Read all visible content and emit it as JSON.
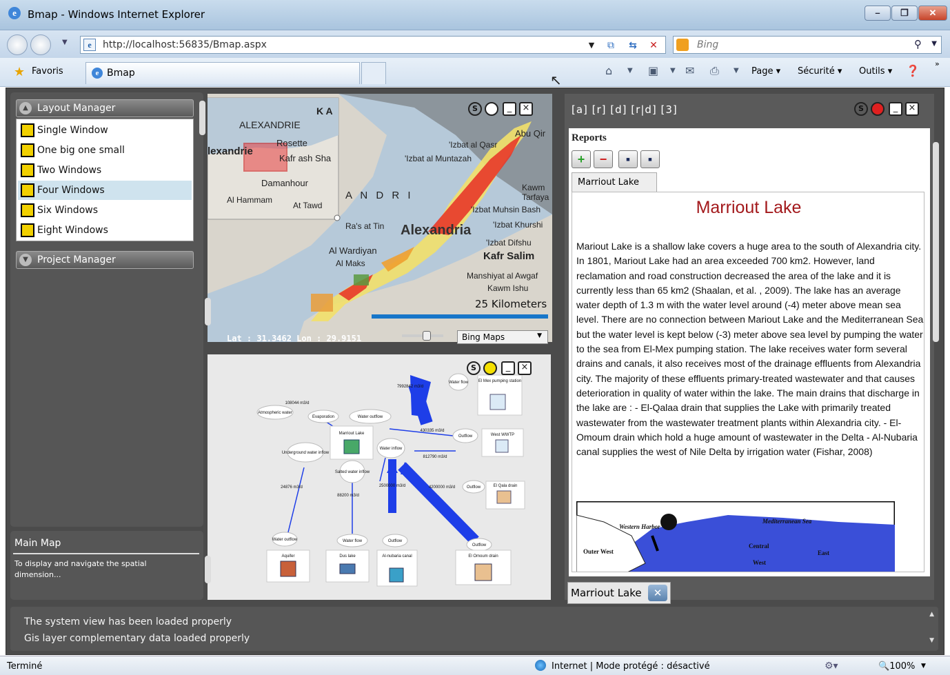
{
  "window": {
    "title": "Bmap - Windows Internet Explorer",
    "controls": {
      "minimize": "–",
      "maximize": "❐",
      "close": "✕"
    }
  },
  "address": {
    "url": "http://localhost:56835/Bmap.aspx",
    "search_placeholder": "Bing"
  },
  "favorites": {
    "label": "Favoris",
    "tab_label": "Bmap"
  },
  "command_bar": {
    "page": "Page ▾",
    "security": "Sécurité ▾",
    "tools": "Outils ▾",
    "more": "»"
  },
  "left_panel": {
    "layout_manager": "Layout Manager",
    "layouts": [
      {
        "label": "Single Window",
        "selected": false
      },
      {
        "label": "One big one small",
        "selected": false
      },
      {
        "label": "Two Windows",
        "selected": false
      },
      {
        "label": "Four Windows",
        "selected": true
      },
      {
        "label": "Six Windows",
        "selected": false
      },
      {
        "label": "Eight Windows",
        "selected": false
      }
    ],
    "project_manager": "Project Manager",
    "info_title": "Main Map",
    "info_text": "To display and navigate the spatial dimension..."
  },
  "map_window": {
    "controls": {
      "s": "S"
    },
    "labels": {
      "ka": "K A",
      "alexandrie": "ALEXANDRIE",
      "alexandrie_city": "lexandrie",
      "rosette": "Rosette",
      "kafr_ash_sh": "Kafr ash Sha",
      "damanhour": "Damanhour",
      "al_hammam": "Al Hammam",
      "at_tawd": "At Tawd",
      "abu_qir": "Abu Qir",
      "izbat_qasr": "'Izbat al Qasr",
      "izbat_muntazah": "'Izbat al Muntazah",
      "andria": "A N D R I",
      "kawm": "Kawm",
      "tarfaya": "Tarfaya",
      "izbat_muhsin": "'Izbat Muhsin Bash",
      "ras_at_tin": "Ra's at Tin",
      "alexandria": "Alexandria",
      "izbat_khurshid": "'Izbat Khurshi",
      "izbat_difshu": "'Izbat Difshu",
      "al_wardiyan": "Al Wardiyan",
      "al_maks": "Al Maks",
      "kafr_salim": "Kafr Salim",
      "manshiyat": "Manshiyat al Awgaf",
      "kawm_ishu": "Kawm Ishu",
      "scale": "25 Kilometers"
    },
    "lat_lon": "Lat : 31.3462   Lon : 29.9151",
    "map_type": "Bing Maps"
  },
  "diagram_window": {
    "controls": {
      "s": "S"
    },
    "labels": {
      "flow_7992": "7992842 m3/d",
      "water_flow_1": "Water flow",
      "el_mex_station": "El Mex pumping station",
      "flow_108044": "108044 m3/d",
      "atmospheric_water": "Atmospheric water",
      "evaporation": "Evaporation",
      "water_outflow": "Water outflow",
      "marriout_lake": "Marriout Lake",
      "flow_430335": "430335 m3/d",
      "outflow_1": "Outflow",
      "west_wwtp": "West WWTP",
      "underground_inflow": "Underground water inflow",
      "water_inflow": "Water inflow",
      "flow_812790": "812790 m3/d",
      "salted_inflow": "Salted water inflow",
      "flow_24876": "24876 m3/d",
      "flow_88200": "88200 m3/d",
      "flow_2500000": "2500000 m3/d",
      "flow_4200000": "4200000 m3/d",
      "outflow_2": "Outflow",
      "el_qala_drain": "El Qala drain",
      "water_outflow_2": "Water outflow",
      "water_flow_2": "Water flow",
      "outflow_3": "Outflow",
      "outflow_4": "Outflow",
      "aquifer": "Aquifer",
      "dus_lake": "Dus lake",
      "al_nubaria": "Al-nubaria canal",
      "el_omoum_drain": "El Omoum drain"
    }
  },
  "report_window": {
    "toolbar_label": "[a] [r] [d] [r|d] [3]",
    "controls": {
      "s": "S"
    },
    "reports_title": "Reports",
    "buttons": {
      "add": "+",
      "remove": "−",
      "save": "▪",
      "save_all": "▪"
    },
    "tab": "Marriout Lake",
    "content_title": "Marriout Lake",
    "content_body": "Mariout Lake is a shallow lake covers a huge area to the south of Alexandria city. In 1801, Mariout Lake had an area exceeded 700 km2. However, land reclamation and road construction decreased the area of the lake and it is currently less than 65 km2 (Shaalan, et al. , 2009). The lake has an average water depth of 1.3 m with the water level around (-4) meter above mean sea level. There are no connection between Mariout Lake and the Mediterranean Sea but the water level is kept below (-3) meter above sea level by pumping the water to the sea from El-Mex pumping station. The lake receives water form several drains and canals, it also receives most of the drainage effluents from Alexandria city. The majority of these effluents primary-treated wastewater and that causes deterioration in quality of water within the lake. The main drains that discharge in the lake are : - El-Qalaa drain that supplies the Lake with primarily treated wastewater from the wastewater treatment plants within Alexandria city. - El-Omoum drain which hold a huge amount of wastewater in the Delta - Al-Nubaria canal supplies the west of Nile Delta by irrigation water (Fishar, 2008)",
    "lake_map_labels": {
      "mediterranean": "Mediterranean Sea",
      "western_harbor": "Western Harbor",
      "central": "Central",
      "east": "East",
      "outer_west": "Outer West",
      "west": "West"
    },
    "footer_tab": "Marriout Lake"
  },
  "log": {
    "lines": [
      "The system view has been loaded properly",
      "Gis layer complementary data loaded properly"
    ]
  },
  "status": {
    "left": "Terminé",
    "zone": "Internet | Mode protégé : désactivé",
    "zoom": "100%"
  },
  "colors": {
    "accent_red": "#a3191c",
    "panel_grey": "#565656",
    "map_blue": "#1776c9"
  }
}
